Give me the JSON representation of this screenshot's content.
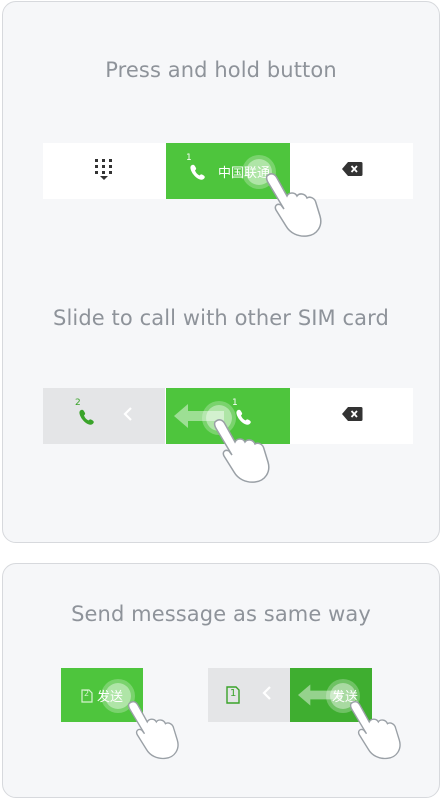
{
  "section1": {
    "heading": "Press and hold button",
    "carrier_label": "中国联通",
    "call_sim": "1"
  },
  "section2": {
    "heading": "Slide to call with other SIM card",
    "sim_left": "2",
    "sim_right": "1"
  },
  "section3": {
    "heading": "Send message as same way",
    "send_label": "发送",
    "sim_left": "2",
    "sim_right": "1"
  },
  "colors": {
    "green": "#4ec53d",
    "dark_green": "#3fae30",
    "gray": "#e4e5e7",
    "text_gray": "#8e939a"
  },
  "icons": [
    "dialpad-icon",
    "phone-icon",
    "backspace-icon",
    "chevron-left-icon",
    "sim-card-icon",
    "hand-pointer-icon"
  ]
}
